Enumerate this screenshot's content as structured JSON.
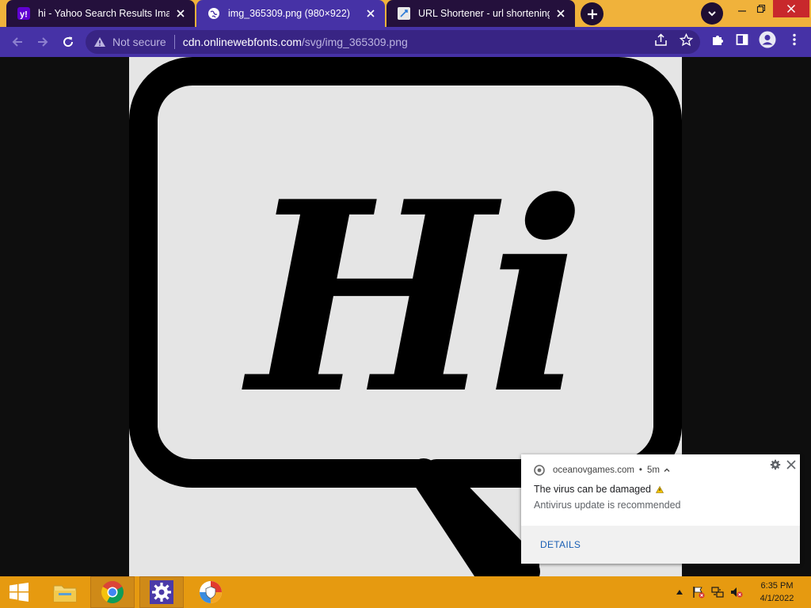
{
  "browser": {
    "tabs": [
      {
        "title": "hi - Yahoo Search Results Image",
        "favicon": "yahoo-icon",
        "active": false
      },
      {
        "title": "img_365309.png (980×922)",
        "favicon": "globe-icon",
        "active": true
      },
      {
        "title": "URL Shortener - url shortening s",
        "favicon": "link-icon",
        "active": false
      }
    ],
    "address": {
      "security_label": "Not secure",
      "host": "cdn.onlinewebfonts.com",
      "path": "/svg/img_365309.png"
    }
  },
  "content": {
    "image_text": "Hi"
  },
  "notification": {
    "source": "oceanovgames.com",
    "separator": "•",
    "time": "5m",
    "title": "The virus can be damaged",
    "message": "Antivirus update is recommended",
    "action": "DETAILS"
  },
  "taskbar": {
    "time": "6:35 PM",
    "date": "4/1/2022"
  },
  "colors": {
    "tabstrip": "#f0b23b",
    "toolbar": "#4632a6",
    "taskbar": "#e69a10",
    "link": "#1a5fb4"
  }
}
